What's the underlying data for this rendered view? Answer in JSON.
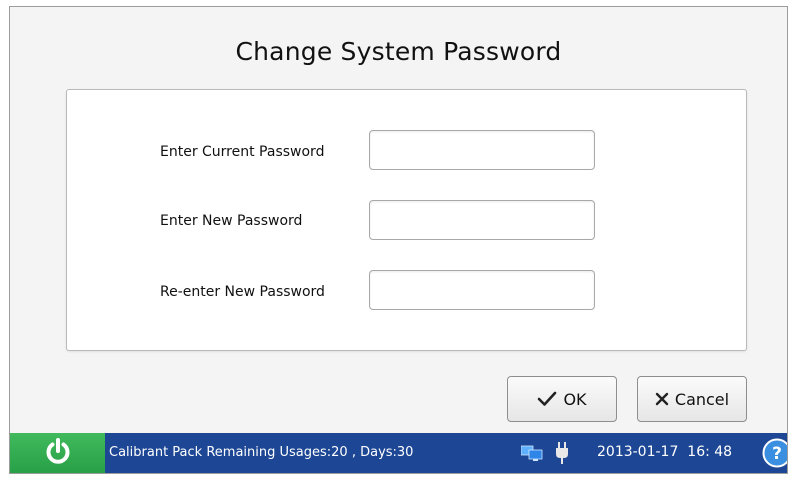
{
  "dialog": {
    "title": "Change System Password",
    "fields": [
      {
        "label": "Enter Current Password",
        "value": ""
      },
      {
        "label": "Enter New Password",
        "value": ""
      },
      {
        "label": "Re-enter New Password",
        "value": ""
      }
    ],
    "ok_label": "OK",
    "cancel_label": "Cancel"
  },
  "status_bar": {
    "message": "Calibrant Pack Remaining Usages:20 , Days:30",
    "date": "2013-01-17",
    "time": "16: 48",
    "colors": {
      "bar": "#1d4795",
      "power": "#2eab4d",
      "help": "#3b8fe0"
    },
    "icons": [
      "power-icon",
      "network-icon",
      "plug-icon",
      "help-icon"
    ]
  }
}
